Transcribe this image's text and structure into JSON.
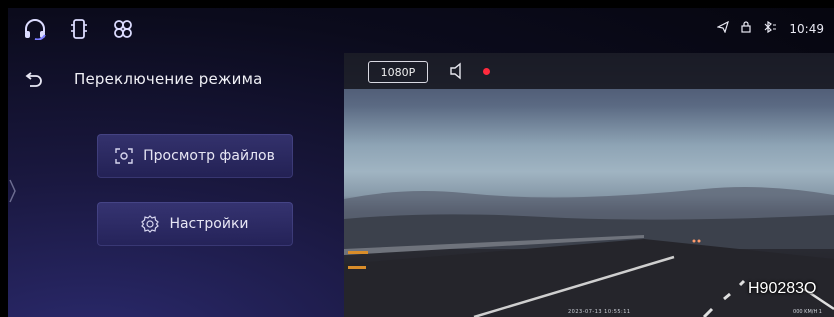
{
  "status_bar": {
    "left_icons": [
      "headphones-icon",
      "phone-icon",
      "fan-icon"
    ],
    "right_icons": [
      "navigation-icon",
      "lock-icon",
      "bluetooth-icon"
    ],
    "time": "10:49"
  },
  "header": {
    "back_icon": "back-arrow-icon",
    "title": "Переключение режима"
  },
  "menu": {
    "files_icon": "camera-view-icon",
    "files_label": "Просмотр файлов",
    "settings_icon": "gear-icon",
    "settings_label": "Настройки"
  },
  "camera": {
    "resolution": "1080P",
    "sound_icon": "speaker-icon",
    "recording_indicator": "rec-dot",
    "recording_color": "#ff2a3d",
    "timestamp": "2023-07-13 10:55:11",
    "speed": "000 KM/H 1"
  },
  "watermark": "H90283O",
  "colors": {
    "accent": "#3e3c80",
    "background": "#0b0b1c",
    "text": "#f0f0f6"
  }
}
